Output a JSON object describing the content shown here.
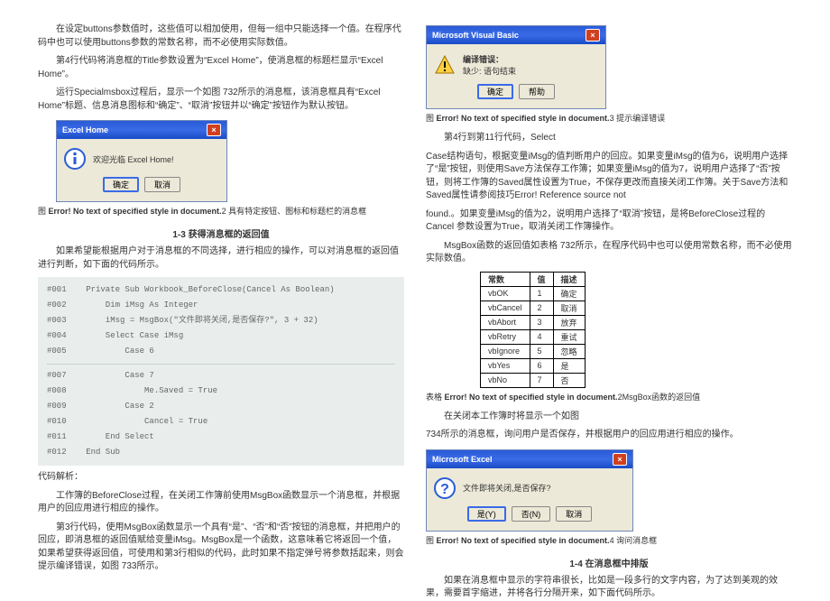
{
  "left": {
    "p1": "在设定buttons参数值时，这些值可以相加使用，但每一组中只能选择一个值。在程序代码中也可以使用buttons参数的常数名称，而不必使用实际数值。",
    "p2": "第4行代码将消息框的Title参数设置为“Excel Home”，使消息框的标题栏显示“Excel Home”。",
    "p3": "运行Specialmsbox过程后，显示一个如图 732所示的消息框，该消息框具有“Excel Home”标题、信息消息图标和“确定”、“取消”按钮并以“确定”按钮作为默认按钮。",
    "dialog1": {
      "title": "Excel Home",
      "msg": "欢迎光临 Excel Home!",
      "btn_ok": "确定",
      "btn_cancel": "取消"
    },
    "caption1_prefix": "图 ",
    "caption1_err": "Error! No text of specified style in document.",
    "caption1_suffix": "2      具有特定按钮、图标和标题栏的消息框",
    "section": "1-3   获得消息框的返回值",
    "p4": "如果希望能根据用户对于消息框的不同选择，进行相应的操作，可以对消息框的返回值进行判断，如下面的代码所示。",
    "code": [
      "#001    Private Sub Workbook_BeforeClose(Cancel As Boolean)",
      "#002        Dim iMsg As Integer",
      "#003        iMsg = MsgBox(\"文件即将关闭,是否保存?\", 3 + 32)",
      "#004        Select Case iMsg",
      "#005            Case 6",
      "",
      "#007            Case 7",
      "#008                Me.Saved = True",
      "#009            Case 2",
      "#010                Cancel = True",
      "#011        End Select",
      "#012    End Sub"
    ],
    "p5": "代码解析：",
    "p6": "工作簿的BeforeClose过程，在关闭工作簿前使用MsgBox函数显示一个消息框，并根据用户的回应用进行相应的操作。",
    "p7": "第3行代码，使用MsgBox函数显示一个具有“是”、“否”和“否”按钮的消息框，并把用户的回应，即消息框的返回值赋给变量iMsg。MsgBox是一个函数，这意味着它将返回一个值，如果希望获得返回值，可使用和第3行相似的代码，此时如果不指定弹号将参数括起来，则会提示编译错误，如图 733所示。"
  },
  "right": {
    "dialog2": {
      "title": "Microsoft Visual Basic",
      "errheader": "编译错误：",
      "errmsg": "缺少: 语句结束",
      "btn_ok": "确定",
      "btn_help": "帮助"
    },
    "caption2_prefix": "图 ",
    "caption2_err": "Error! No text of specified style in document.",
    "caption2_suffix": "3      提示编译错误",
    "p1": "第4行到第11行代码，Select",
    "p2": "Case结构语句，根据变量iMsg的值判断用户的回应。如果变量iMsg的值为6，说明用户选择了“是”按钮，则使用Save方法保存工作簿；如果变量iMsg的值为7，说明用户选择了“否”按钮，则将工作簿的Saved属性设置为True，不保存更改而直接关闭工作簿。关于Save方法和Saved属性请参阅技巧Error! Reference source not",
    "p3": "found.。如果变量iMsg的值为2，说明用户选择了“取消”按钮，是将BeforeClose过程的Cancel 参数设置为True，取消关闭工作簿操作。",
    "p4": "MsgBox函数的返回值如表格 732所示，在程序代码中也可以使用常数名称，而不必使用实际数值。",
    "table": {
      "headers": [
        "常数",
        "值",
        "描述"
      ],
      "rows": [
        [
          "vbOK",
          "1",
          "确定"
        ],
        [
          "vbCancel",
          "2",
          "取消"
        ],
        [
          "vbAbort",
          "3",
          "放弃"
        ],
        [
          "vbRetry",
          "4",
          "重试"
        ],
        [
          "vbIgnore",
          "5",
          "忽略"
        ],
        [
          "vbYes",
          "6",
          "是"
        ],
        [
          "vbNo",
          "7",
          "否"
        ]
      ]
    },
    "caption3_prefix": "表格 ",
    "caption3_err": "Error! No text of specified style in document.",
    "caption3_suffix": "2MsgBox函数的返回值",
    "p5": "在关闭本工作簿时将显示一个如图",
    "p6": "734所示的消息框，询问用户是否保存，并根据用户的回应用进行相应的操作。",
    "dialog3": {
      "title": "Microsoft Excel",
      "msg": "文件即将关闭,是否保存?",
      "btn_yes": "是(Y)",
      "btn_no": "否(N)",
      "btn_cancel": "取消"
    },
    "caption4_prefix": "图 ",
    "caption4_err": "Error! No text of specified style in document.",
    "caption4_suffix": "4      询问消息框",
    "section": "1-4   在消息框中排版",
    "p7": "如果在消息框中显示的字符串很长，比如是一段多行的文字内容，为了达到美观的效果，需要首字缩进，并将各行分隔开来，如下面代码所示。"
  }
}
